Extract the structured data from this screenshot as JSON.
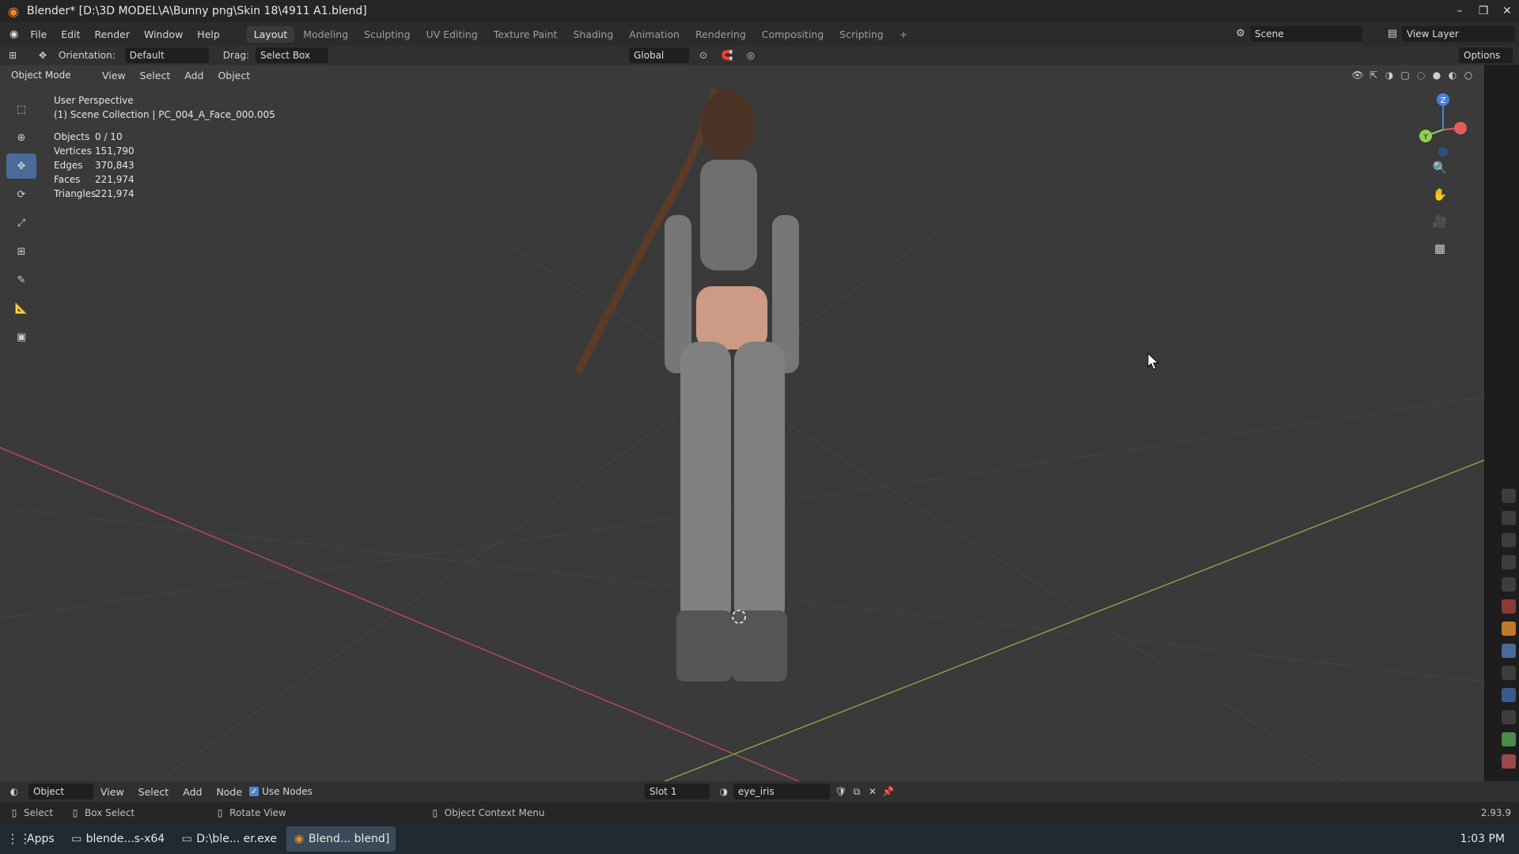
{
  "window": {
    "title": "Blender* [D:\\3D MODEL\\A\\Bunny png\\Skin 18\\4911 A1.blend]",
    "controls": [
      "–",
      "❐",
      "✕"
    ]
  },
  "menubar": {
    "menus": [
      "File",
      "Edit",
      "Render",
      "Window",
      "Help"
    ],
    "workspaces": [
      "Layout",
      "Modeling",
      "Sculpting",
      "UV Editing",
      "Texture Paint",
      "Shading",
      "Animation",
      "Rendering",
      "Compositing",
      "Scripting"
    ],
    "active_workspace": "Layout",
    "add_tab": "+",
    "scene": "Scene",
    "view_layer": "View Layer"
  },
  "tool_header": {
    "orientation_label": "Orientation:",
    "orientation_value": "Default",
    "drag_label": "Drag:",
    "drag_value": "Select Box",
    "transform_orientation": "Global",
    "options": "Options"
  },
  "viewport_header": {
    "mode": "Object Mode",
    "menus": [
      "View",
      "Select",
      "Add",
      "Object"
    ]
  },
  "overlay_text": {
    "perspective": "User Perspective",
    "collection": "(1) Scene Collection | PC_004_A_Face_000.005",
    "stats": [
      {
        "label": "Objects",
        "value": "0 / 10"
      },
      {
        "label": "Vertices",
        "value": "151,790"
      },
      {
        "label": "Edges",
        "value": "370,843"
      },
      {
        "label": "Faces",
        "value": "221,974"
      },
      {
        "label": "Triangles",
        "value": "221,974"
      }
    ]
  },
  "gizmo": {
    "z": "Z",
    "y": "Y",
    "x": "X"
  },
  "bottom_header": {
    "editor_mode": "Object",
    "menus": [
      "View",
      "Select",
      "Add",
      "Node"
    ],
    "use_nodes_label": "Use Nodes",
    "use_nodes_checked": true,
    "slot": "Slot 1",
    "material": "eye_iris"
  },
  "statusbar": {
    "select": "Select",
    "box_select": "Box Select",
    "rotate_view": "Rotate View",
    "context_menu": "Object Context Menu",
    "version": "2.93.9"
  },
  "taskbar": {
    "apps_label": "Apps",
    "items": [
      "blende...s-x64",
      "D:\\ble... er.exe",
      "Blend... blend]"
    ],
    "active_index": 2,
    "clock": "1:03 PM"
  },
  "colors": {
    "accent": "#4a88d8",
    "x_axis": "#e35b5b",
    "y_axis": "#8fd14f",
    "z_axis": "#4a7fd8",
    "viewport_bg": "#3a3a3a",
    "blender_orange": "#f08a24"
  }
}
